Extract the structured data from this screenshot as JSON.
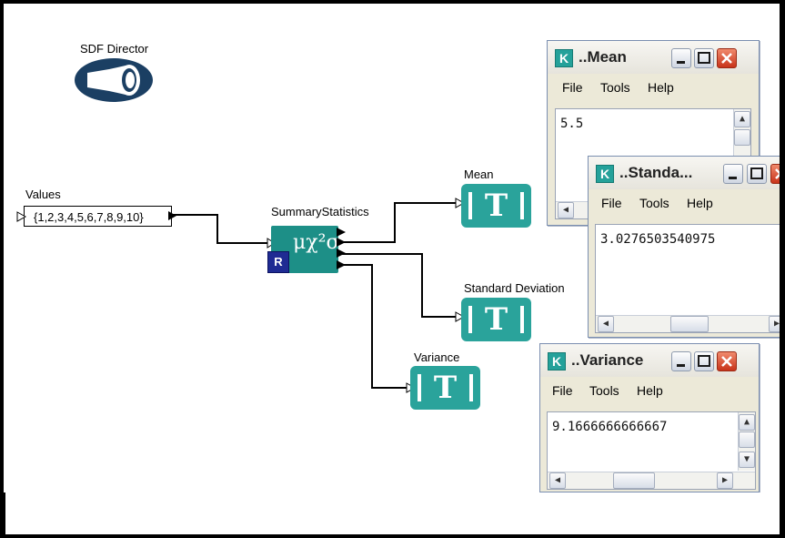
{
  "director": {
    "label": "SDF Director"
  },
  "constant": {
    "label": "Values",
    "value": "{1,2,3,4,5,6,7,8,9,10}"
  },
  "actor": {
    "label": "SummaryStatistics",
    "badge": "R",
    "glyph": "μχ²σ"
  },
  "displays": [
    {
      "label": "Mean",
      "glyph": "T"
    },
    {
      "label": "Standard Deviation",
      "glyph": "T"
    },
    {
      "label": "Variance",
      "glyph": "T"
    }
  ],
  "windows": {
    "mean": {
      "icon": "K",
      "title": "..Mean",
      "menu": [
        "File",
        "Tools",
        "Help"
      ],
      "value": "5.5"
    },
    "stddev": {
      "icon": "K",
      "title": "..Standa...",
      "menu": [
        "File",
        "Tools",
        "Help"
      ],
      "value": "3.0276503540975"
    },
    "variance": {
      "icon": "K",
      "title": "..Variance",
      "menu": [
        "File",
        "Tools",
        "Help"
      ],
      "value": "9.1666666666667"
    }
  },
  "icons": {
    "minimize": "minimize-icon",
    "maximize": "maximize-icon",
    "close": "close-icon",
    "scroll_up": "scroll-up-icon",
    "scroll_down": "scroll-down-icon",
    "scroll_left": "scroll-left-icon",
    "scroll_right": "scroll-right-icon"
  },
  "colors": {
    "actor": "#1d8f87",
    "display": "#2aa39b",
    "badge": "#1f2b93",
    "director": "#1b3f63"
  }
}
